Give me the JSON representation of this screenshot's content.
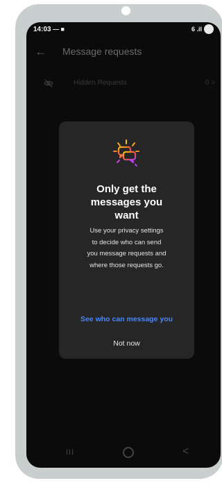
{
  "status_bar": {
    "time": "14:03",
    "left_icons": "— ■",
    "right_icons": "6 .il"
  },
  "header": {
    "title": "Message requests"
  },
  "hidden_requests": {
    "label": "Hidden Requests",
    "count": "0 >"
  },
  "dialog": {
    "title_line1": "Only get the",
    "title_line2": "messages you",
    "title_line3": "want",
    "body_line1": "Use your privacy settings",
    "body_line2": "to decide who can send",
    "body_line3": "you message requests and",
    "body_line4": "where those requests go.",
    "primary_label": "See who can message you",
    "secondary_label": "Not now"
  },
  "nav": {
    "recents": "III",
    "back": "<"
  },
  "colors": {
    "accent": "#4a86f7",
    "dialog_bg": "#262626",
    "screen_bg": "#0b0b0b"
  }
}
